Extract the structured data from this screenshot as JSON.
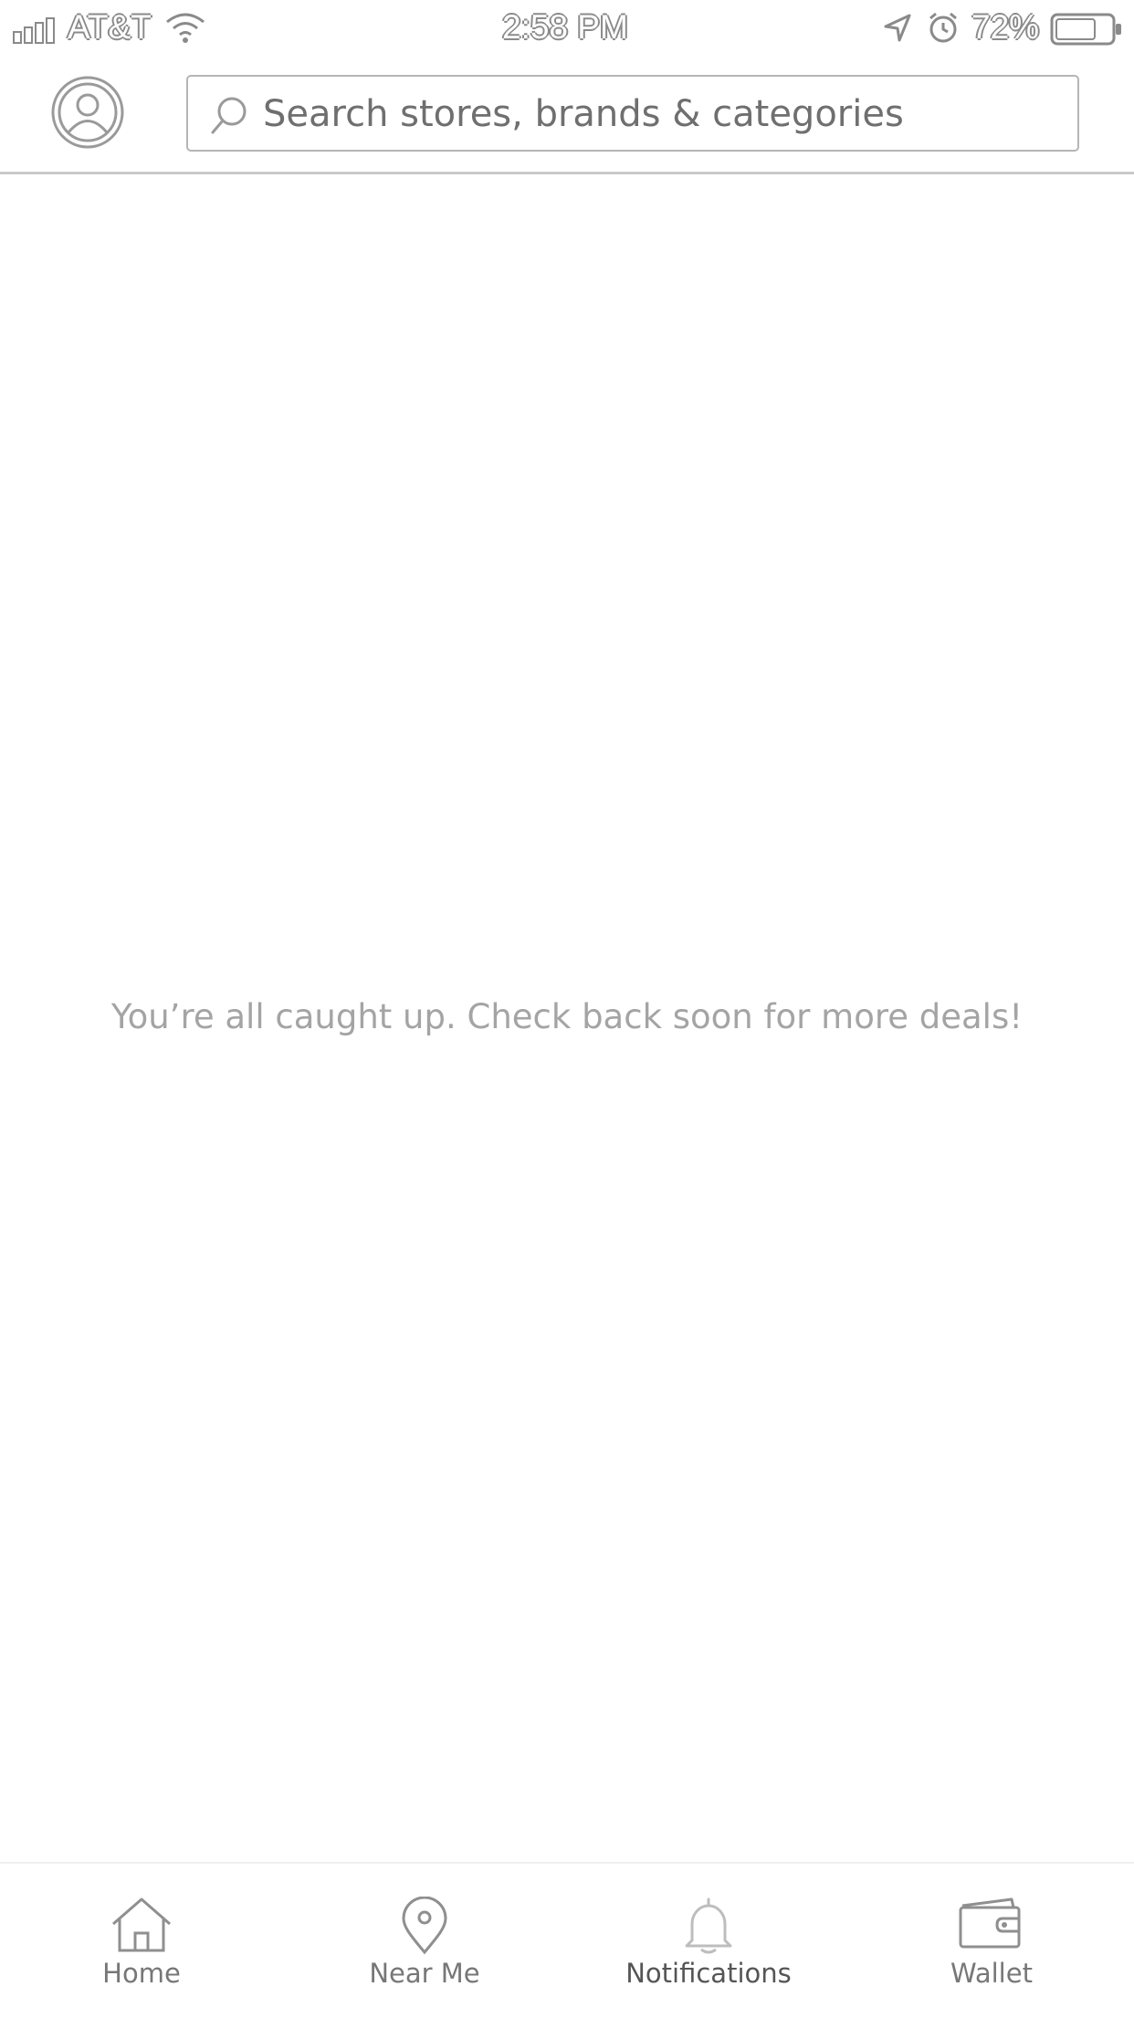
{
  "status_bar": {
    "carrier": "AT&T",
    "time": "2:58 PM",
    "battery": "72%"
  },
  "search": {
    "placeholder": "Search stores, brands & categories"
  },
  "empty_state": {
    "message": "You’re all caught up. Check back soon for more deals!"
  },
  "tabs": [
    {
      "label": "Home",
      "icon": "home-icon"
    },
    {
      "label": "Near Me",
      "icon": "location-pin-icon"
    },
    {
      "label": "Notifications",
      "icon": "bell-icon",
      "active": true
    },
    {
      "label": "Wallet",
      "icon": "wallet-icon"
    }
  ],
  "colors": {
    "icon_gray": "#8f8f8f",
    "message_gray": "#a4a4a4",
    "divider": "#c9c9c9"
  }
}
